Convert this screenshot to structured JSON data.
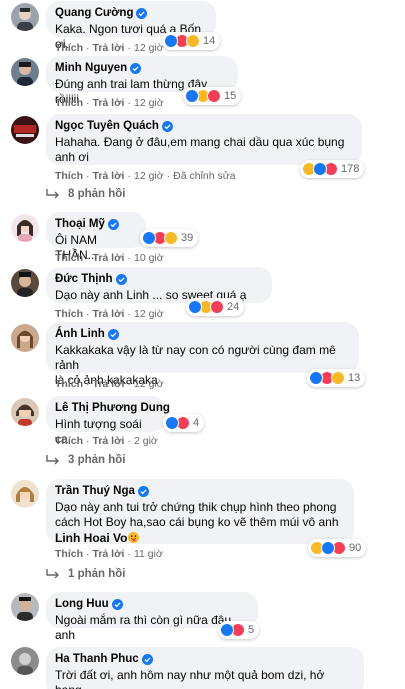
{
  "comments": [
    {
      "author": "Quang Cường",
      "text": "Kaka. Ngon tươi quá a Bốn ơi.",
      "like": "Thích",
      "reply": "Trả lời",
      "time": "12 giờ",
      "reaction_count": "14",
      "reactions": [
        "like",
        "love",
        "haha"
      ]
    },
    {
      "author": "Minh Nguyen",
      "text": "Đúng anh trai lam thừng đây rồiiiii",
      "like": "Thích",
      "reply": "Trả lời",
      "time": "12 giờ",
      "reaction_count": "15",
      "reactions": [
        "like",
        "wow",
        "love"
      ]
    },
    {
      "author": "Ngọc Tuyên Quách",
      "text": "Hahaha. Đang ở đâu,em mang chai dầu qua xúc bụng\nanh ơi",
      "like": "Thích",
      "reply": "Trả lời",
      "time": "12 giờ",
      "edited": "Đã chỉnh sửa",
      "reaction_count": "178",
      "reactions": [
        "haha",
        "like",
        "love"
      ],
      "replies_label": "8 phản hồi"
    },
    {
      "author": "Thoại Mỹ",
      "text": "Ôi NAM THẦN...",
      "like": "Thích",
      "reply": "Trả lời",
      "time": "10 giờ",
      "reaction_count": "39",
      "reactions": [
        "like",
        "love",
        "haha"
      ]
    },
    {
      "author": "Đức Thịnh",
      "text": "Dạo này anh Linh ... so sweet quá ạ",
      "like": "Thích",
      "reply": "Trả lời",
      "time": "12 giờ",
      "reaction_count": "24",
      "reactions": [
        "like",
        "haha",
        "love"
      ]
    },
    {
      "author": "Ánh Linh",
      "text": "Kakkakaka vậy là từ nay con có người cùng đam mê rảnh\nlà cỏ ảnh kakakaka",
      "like": "Thích",
      "reply": "Trả lời",
      "time": "12 giờ",
      "reaction_count": "13",
      "reactions": [
        "like",
        "love",
        "haha"
      ]
    },
    {
      "author": "Lê Thị Phương Dung",
      "text": "Hình tượng soái ca",
      "like": "Thích",
      "reply": "Trả lời",
      "time": "2 giờ",
      "reaction_count": "4",
      "reactions": [
        "like",
        "love"
      ],
      "replies_label": "3 phản hồi"
    },
    {
      "author": "Trần Thuý Nga",
      "text": "Dạo này anh tui trở chứng thik chụp hình theo phong\ncách Hot Boy ha,sao cái bụng ko vẽ thêm múi vô anh",
      "tag": "Linh Hoai Vo",
      "like": "Thích",
      "reply": "Trả lời",
      "time": "11 giờ",
      "reaction_count": "90",
      "reactions": [
        "haha",
        "like",
        "love"
      ],
      "replies_label": "1 phản hồi"
    },
    {
      "author": "Long Huu",
      "text": "Ngoài mắm ra thì còn gì nữa đâu anh",
      "like": "Thích",
      "reply": "Trả lời",
      "time": "12 giờ",
      "reaction_count": "5",
      "reactions": [
        "like",
        "love"
      ]
    },
    {
      "author": "Ha Thanh Phuc",
      "text": "Trời đất ơi, anh hôm nay như một quả bom dzi, hở hang\nquá nè :))"
    }
  ],
  "colors": {
    "bubble": "#f0f2f5",
    "meta": "#65676b",
    "like_blue": "#1877f2",
    "love_red": "#f33e58",
    "haha_yellow": "#f7b928"
  }
}
